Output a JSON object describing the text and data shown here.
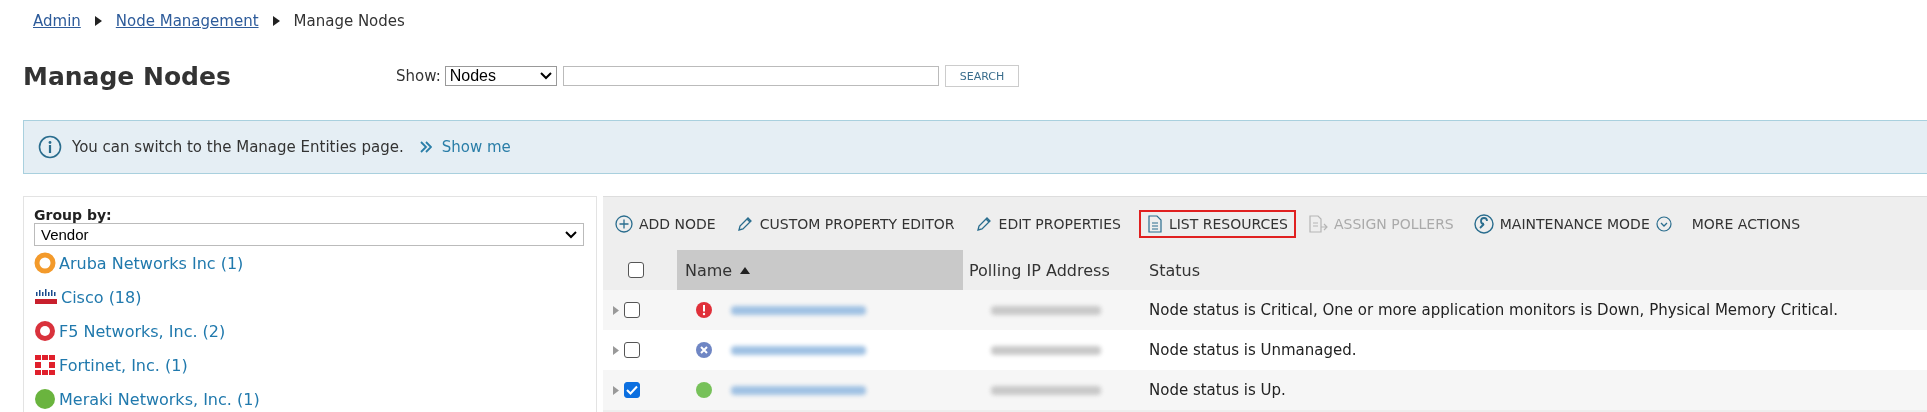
{
  "breadcrumb": [
    {
      "label": "Admin",
      "kind": "link"
    },
    {
      "label": "Node Management",
      "kind": "link"
    },
    {
      "label": "Manage Nodes",
      "kind": "current"
    }
  ],
  "page_title": "Manage Nodes",
  "show_filter": {
    "label": "Show:",
    "value": "Nodes",
    "search_button": "SEARCH"
  },
  "info_bar": {
    "message": "You can switch to the Manage Entities page.",
    "link": "Show me"
  },
  "group_by": {
    "label": "Group by:",
    "value": "Vendor",
    "items": [
      {
        "label": "Aruba Networks Inc (1)",
        "kind": "aruba"
      },
      {
        "label": "Cisco (18)",
        "kind": "cisco"
      },
      {
        "label": "F5 Networks, Inc. (2)",
        "kind": "f5"
      },
      {
        "label": "Fortinet, Inc. (1)",
        "kind": "fortinet"
      },
      {
        "label": "Meraki Networks, Inc. (1)",
        "kind": "meraki"
      }
    ]
  },
  "toolbar": [
    {
      "label": "ADD NODE",
      "kind": "add",
      "disabled": false,
      "highlighted": false
    },
    {
      "label": "CUSTOM PROPERTY EDITOR",
      "kind": "edit",
      "disabled": false,
      "highlighted": false
    },
    {
      "label": "EDIT PROPERTIES",
      "kind": "edit",
      "disabled": false,
      "highlighted": false
    },
    {
      "label": "LIST RESOURCES",
      "kind": "list",
      "disabled": false,
      "highlighted": true
    },
    {
      "label": "ASSIGN POLLERS",
      "kind": "assign",
      "disabled": true,
      "highlighted": false
    },
    {
      "label": "MAINTENANCE MODE",
      "kind": "maintenance",
      "disabled": false,
      "highlighted": false
    },
    {
      "label": "MORE ACTIONS",
      "kind": "more",
      "disabled": false,
      "highlighted": false
    }
  ],
  "table": {
    "select_all_checked": false,
    "columns": [
      {
        "label": "Name",
        "sorted": true
      },
      {
        "label": "Polling IP Address",
        "sorted": false
      },
      {
        "label": "Status",
        "sorted": false
      }
    ],
    "rows": [
      {
        "checked": false,
        "kind": "critical",
        "status_text": "Node status is Critical, One or more application monitors is Down, Physical Memory Critical."
      },
      {
        "checked": false,
        "kind": "unmanaged",
        "status_text": "Node status is Unmanaged."
      },
      {
        "checked": true,
        "kind": "up",
        "status_text": "Node status is Up."
      }
    ]
  }
}
